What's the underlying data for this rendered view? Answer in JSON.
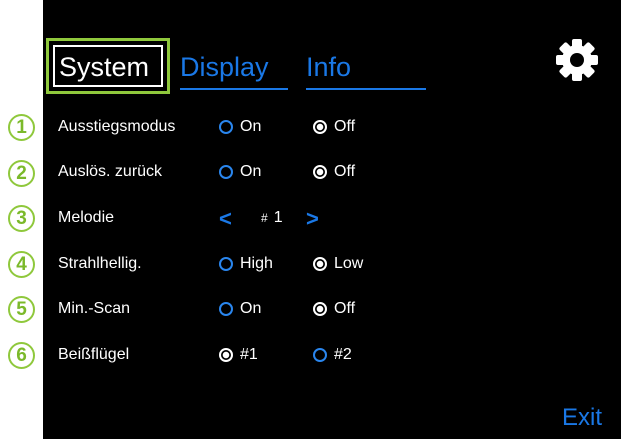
{
  "tabs": {
    "system": "System",
    "display": "Display",
    "info": "Info"
  },
  "settings": [
    {
      "badge": "1",
      "label": "Ausstiegsmodus",
      "opt1": "On",
      "opt2": "Off",
      "selected": 2
    },
    {
      "badge": "2",
      "label": "Auslös. zurück",
      "opt1": "On",
      "opt2": "Off",
      "selected": 2
    },
    {
      "badge": "3",
      "label": "Melodie",
      "hash": "#",
      "value": "1"
    },
    {
      "badge": "4",
      "label": "Strahlhellig.",
      "opt1": "High",
      "opt2": "Low",
      "selected": 2
    },
    {
      "badge": "5",
      "label": "Min.-Scan",
      "opt1": "On",
      "opt2": "Off",
      "selected": 2
    },
    {
      "badge": "6",
      "label": "Beißflügel",
      "opt1": "#1",
      "opt2": "#2",
      "selected": 1
    }
  ],
  "icons": {
    "settings": "gear-icon",
    "prev": "chevron-left-icon",
    "next": "chevron-right-icon"
  },
  "exit": "Exit",
  "colors": {
    "accent": "#1a78e6",
    "badge": "#8fc83c",
    "screen": "#000000"
  }
}
